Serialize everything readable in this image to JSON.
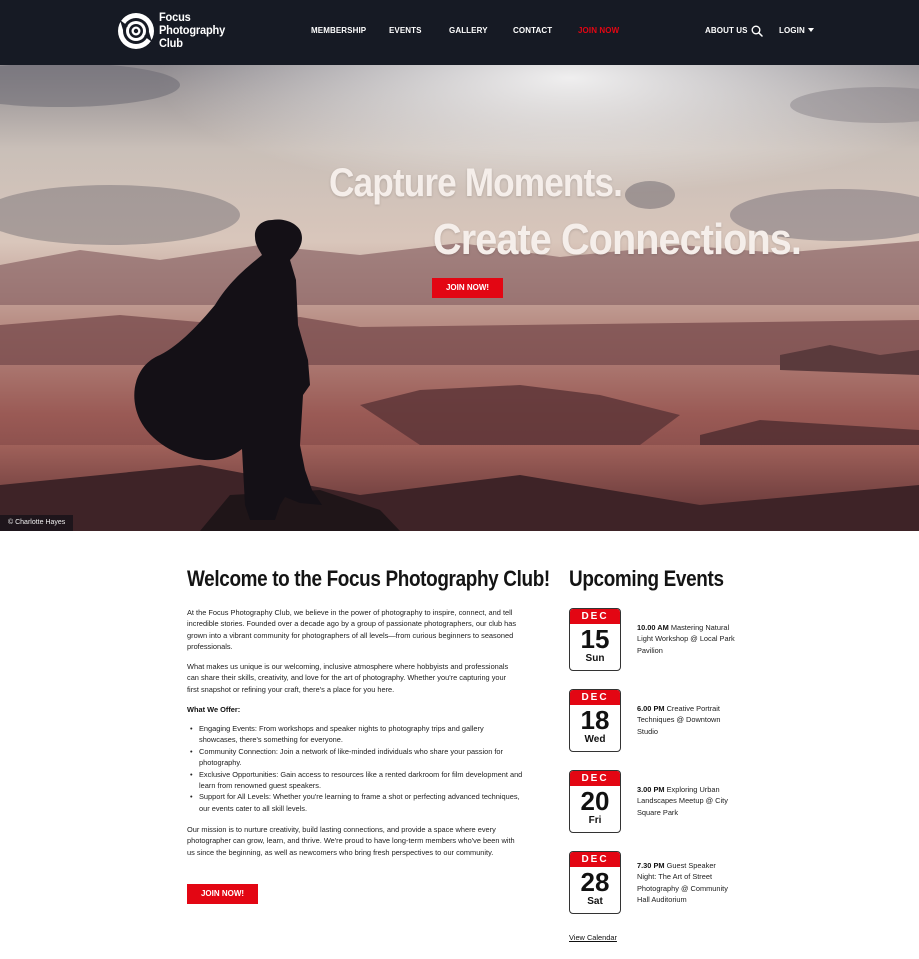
{
  "brand": {
    "line1": "Focus",
    "line2": "Photography",
    "line3": "Club"
  },
  "nav": {
    "membership": "MEMBERSHIP",
    "events": "EVENTS",
    "gallery": "GALLERY",
    "contact": "CONTACT",
    "join": "JOIN NOW",
    "about": "ABOUT US",
    "login": "LOGIN"
  },
  "hero": {
    "line1": "Capture Moments.",
    "line2": "Create Connections.",
    "button": "JOIN NOW!",
    "credit": "© Charlotte Hayes"
  },
  "welcome": {
    "title": "Welcome to the Focus Photography Club!",
    "p1": "At the Focus Photography Club, we believe in the power of photography to inspire, connect, and tell incredible stories. Founded over a decade ago by a group of passionate photographers, our club has grown into a vibrant community for photographers of all levels—from curious beginners to seasoned professionals.",
    "p2": "What makes us unique is our welcoming, inclusive atmosphere where hobbyists and professionals can share their skills, creativity, and love for the art of photography. Whether you're capturing your first snapshot or refining your craft, there's a place for you here.",
    "offer_title": "What We Offer:",
    "offers": [
      "Engaging Events: From workshops and speaker nights to photography trips and gallery showcases, there's something for everyone.",
      "Community Connection: Join a network of like-minded individuals who share your passion for photography.",
      "Exclusive Opportunities: Gain access to resources like a rented darkroom for film development and learn from renowned guest speakers.",
      "Support for All Levels: Whether you're learning to frame a shot or perfecting advanced techniques, our events cater to all skill levels."
    ],
    "p3": "Our mission is to nurture creativity, build lasting connections, and provide a space where every photographer can grow, learn, and thrive. We're proud to have long-term members who've been with us since the beginning, as well as newcomers who bring fresh perspectives to our community.",
    "button": "JOIN NOW!"
  },
  "events": {
    "title": "Upcoming Events",
    "items": [
      {
        "month": "DEC",
        "day": "15",
        "weekday": "Sun",
        "time": "10.00 AM",
        "desc": "Mastering Natural Light Workshop @ Local Park Pavilion"
      },
      {
        "month": "DEC",
        "day": "18",
        "weekday": "Wed",
        "time": "6.00 PM",
        "desc": "Creative Portrait Techniques @ Downtown Studio"
      },
      {
        "month": "DEC",
        "day": "20",
        "weekday": "Fri",
        "time": "3.00 PM",
        "desc": "Exploring Urban Landscapes Meetup @ City Square Park"
      },
      {
        "month": "DEC",
        "day": "28",
        "weekday": "Sat",
        "time": "7.30 PM",
        "desc": "Guest Speaker Night: The Art of Street Photography @ Community Hall Auditorium"
      }
    ],
    "view_calendar": "View Calendar"
  },
  "colors": {
    "header_bg": "#161a24",
    "accent": "#e30613"
  }
}
